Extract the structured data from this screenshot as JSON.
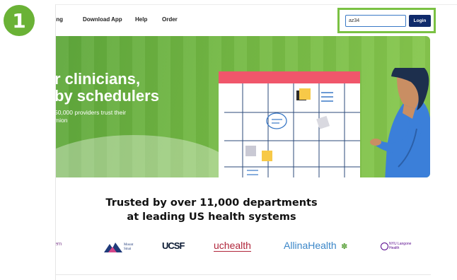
{
  "step_badge": "1",
  "nav": {
    "items": [
      "ing",
      "Download App",
      "Help",
      "Order"
    ]
  },
  "login": {
    "input_value": "az34",
    "button_label": "Login"
  },
  "hero": {
    "title_line1": "r clinicians,",
    "title_line2": "by schedulers",
    "sub_line1": "50,000 providers trust their",
    "sub_line2": "mion"
  },
  "trusted": {
    "line1": "Trusted by over 11,000 departments",
    "line2": "at leading US health systems"
  },
  "logos": {
    "partial": "ern",
    "mount_sinai_1": "Mount",
    "mount_sinai_2": "Sinai",
    "ucsf": "UCSF",
    "uchealth": "uchealth",
    "allina": "AllinaHealth",
    "nyu_1": "NYU Langone",
    "nyu_2": "Health"
  },
  "colors": {
    "accent_green": "#6ab236",
    "login_button": "#0f2a6b",
    "calendar_header": "#f0566b"
  }
}
